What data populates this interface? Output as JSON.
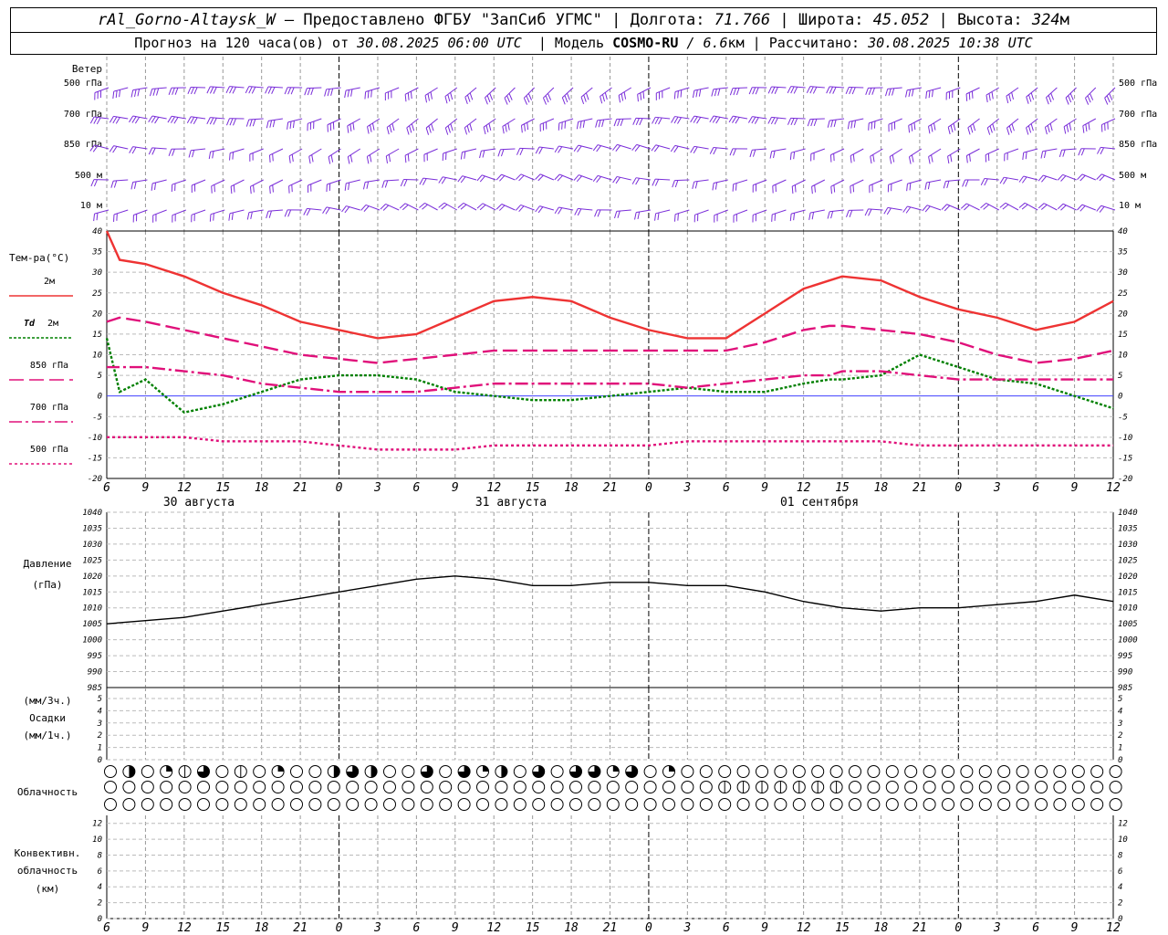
{
  "header": {
    "station": "rAl_Gorno-Altaysk_W",
    "provided_prefix": "– Предоставлено ФГБУ \"ЗапСиб УГМС\"",
    "lon_label": "| Долгота:",
    "lon_value": "71.766",
    "lat_label": "| Широта:",
    "lat_value": "45.052",
    "alt_label": "| Высота:",
    "alt_value": "324",
    "alt_unit": "м",
    "forecast_prefix": "Прогноз на 120 часа(ов) от",
    "forecast_start": "30.08.2025 06:00 UTC",
    "model_label": "| Модель",
    "model_name": "COSMO-RU",
    "model_res": "/ 6.6",
    "model_res_unit": "км",
    "calc_label": "| Рассчитано:",
    "calc_time": "30.08.2025 10:38 UTC"
  },
  "labels": {
    "wind": "Ветер",
    "levels": [
      "500 гПа",
      "700 гПа",
      "850 гПа",
      "500 м",
      "10 м"
    ],
    "temp_title": "Тем-ра(°C)",
    "legend": [
      {
        "text": "2м",
        "prefix": "",
        "color": "#ee3333",
        "dash": "solid"
      },
      {
        "text": "2м",
        "prefix": "Td",
        "color": "#008000",
        "dash": "dotted"
      },
      {
        "text": "850 гПа",
        "prefix": "",
        "color": "#e0107a",
        "dash": "long-dash"
      },
      {
        "text": "700 гПа",
        "prefix": "",
        "color": "#e0107a",
        "dash": "dash-dot"
      },
      {
        "text": "500 гПа",
        "prefix": "",
        "color": "#e0107a",
        "dash": "short-dash"
      }
    ],
    "pressure_title": [
      "Давление",
      "(гПа)"
    ],
    "precip_title": [
      "(мм/3ч.)",
      "Осадки",
      "(мм/1ч.)"
    ],
    "cloud_title": "Облачность",
    "conv_title": [
      "Конвективн.",
      "облачность",
      "(км)"
    ],
    "dates": [
      "30 августа",
      "31 августа",
      "01 сентября"
    ]
  },
  "chart_data": {
    "type": "line",
    "x_unit": "hours UTC since 30.08.2025 06:00",
    "x_ticks": [
      "6",
      "9",
      "12",
      "15",
      "18",
      "21",
      "0",
      "3",
      "6",
      "9",
      "12",
      "15",
      "18",
      "21",
      "0",
      "3",
      "6",
      "9",
      "12",
      "15",
      "18",
      "21",
      "0",
      "3",
      "6",
      "9",
      "12"
    ],
    "temperature": {
      "ylim": [
        -20,
        40
      ],
      "yticks": [
        40,
        35,
        30,
        25,
        20,
        15,
        10,
        5,
        0,
        -5,
        -10,
        -15,
        -20
      ],
      "x": [
        0,
        1,
        3,
        6,
        9,
        12,
        15,
        18,
        21,
        24,
        27,
        30,
        33,
        36,
        39,
        42,
        45,
        48,
        51,
        54,
        56,
        57,
        60,
        63,
        66,
        69,
        72,
        75,
        78
      ],
      "series": [
        {
          "name": "2м",
          "color": "#ee3333",
          "values": [
            40,
            33,
            32,
            29,
            25,
            22,
            18,
            16,
            14,
            15,
            19,
            23,
            24,
            23,
            19,
            16,
            14,
            14,
            20,
            26,
            28,
            29,
            28,
            24,
            21,
            19,
            16,
            18,
            23
          ]
        },
        {
          "name": "Td 2м",
          "color": "#008000",
          "values": [
            14,
            1,
            4,
            -4,
            -2,
            1,
            4,
            5,
            5,
            4,
            1,
            0,
            -1,
            -1,
            0,
            1,
            2,
            1,
            1,
            3,
            4,
            4,
            5,
            10,
            7,
            4,
            3,
            0,
            -3
          ]
        },
        {
          "name": "850 гПа",
          "color": "#e0107a",
          "values": [
            18,
            19,
            18,
            16,
            14,
            12,
            10,
            9,
            8,
            9,
            10,
            11,
            11,
            11,
            11,
            11,
            11,
            11,
            13,
            16,
            17,
            17,
            16,
            15,
            13,
            10,
            8,
            9,
            11
          ]
        },
        {
          "name": "700 гПа",
          "color": "#e0107a",
          "values": [
            7,
            7,
            7,
            6,
            5,
            3,
            2,
            1,
            1,
            1,
            2,
            3,
            3,
            3,
            3,
            3,
            2,
            3,
            4,
            5,
            5,
            6,
            6,
            5,
            4,
            4,
            4,
            4,
            4
          ]
        },
        {
          "name": "500 гПа",
          "color": "#e0107a",
          "values": [
            -10,
            -10,
            -10,
            -10,
            -11,
            -11,
            -11,
            -12,
            -13,
            -13,
            -13,
            -12,
            -12,
            -12,
            -12,
            -12,
            -11,
            -11,
            -11,
            -11,
            -11,
            -11,
            -11,
            -12,
            -12,
            -12,
            -12,
            -12,
            -12
          ]
        }
      ]
    },
    "pressure": {
      "ylim": [
        985,
        1040
      ],
      "yticks": [
        1040,
        1035,
        1030,
        1025,
        1020,
        1015,
        1010,
        1005,
        1000,
        995,
        990,
        985
      ],
      "x": [
        0,
        3,
        6,
        9,
        12,
        15,
        18,
        21,
        24,
        27,
        30,
        33,
        36,
        39,
        42,
        45,
        48,
        51,
        54,
        57,
        60,
        63,
        66,
        69,
        72,
        75,
        78
      ],
      "values": [
        1005,
        1006,
        1007,
        1009,
        1011,
        1013,
        1015,
        1017,
        1019,
        1020,
        1019,
        1017,
        1017,
        1018,
        1018,
        1017,
        1017,
        1015,
        1012,
        1010,
        1009,
        1010,
        1010,
        1011,
        1012,
        1014,
        1012
      ]
    },
    "precip": {
      "ylim": [
        0,
        5
      ],
      "yticks": [
        5,
        4,
        3,
        2,
        1,
        0
      ],
      "values": []
    },
    "convective": {
      "ylim": [
        0,
        13
      ],
      "yticks": [
        12,
        10,
        8,
        6,
        4,
        2,
        0
      ],
      "values": []
    },
    "cloud_rows": [
      "0302140102003430040423040442402000000000000000000000000",
      "0000000000000000000000000000000001111111000000000000000",
      "0000000000000000000000000000000000000000000000000000000"
    ],
    "wind": {
      "rows": [
        "500 гПа",
        "700 гПа",
        "850 гПа",
        "500 м",
        "10 м"
      ],
      "color": "#7a2ed9"
    }
  }
}
